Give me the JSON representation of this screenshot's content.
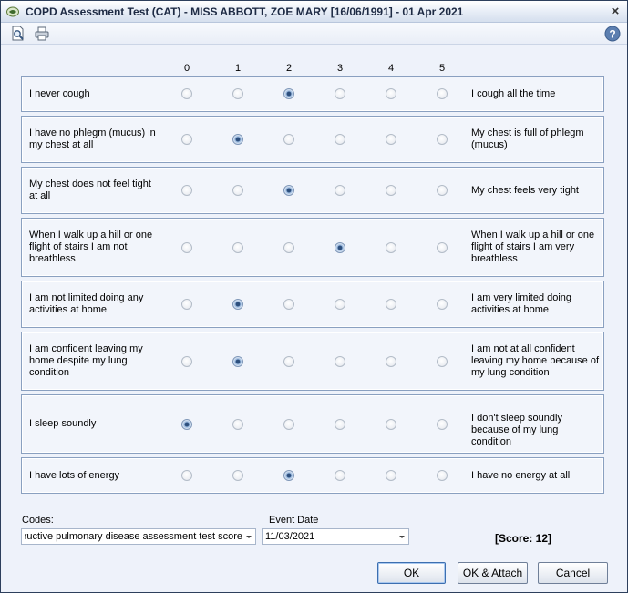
{
  "window": {
    "title": "COPD Assessment Test (CAT) - MISS ABBOTT, ZOE MARY [16/06/1991] - 01 Apr 2021",
    "close_label": "×"
  },
  "toolbar": {
    "preview_icon": "print-preview-icon",
    "print_icon": "printer-icon",
    "help_icon": "help-icon",
    "help_label": "?"
  },
  "scale": [
    "0",
    "1",
    "2",
    "3",
    "4",
    "5"
  ],
  "questions": [
    {
      "left": "I never cough",
      "right": "I cough all the time",
      "selected": 2
    },
    {
      "left": "I have no phlegm (mucus) in my chest at all",
      "right": "My chest is full of phlegm (mucus)",
      "selected": 1
    },
    {
      "left": "My chest does not feel tight at all",
      "right": "My chest feels very tight",
      "selected": 2
    },
    {
      "left": "When I walk up a hill or one flight of stairs I am not breathless",
      "right": "When I walk up a hill or one flight of stairs I am very breathless",
      "selected": 3
    },
    {
      "left": "I am not limited doing any activities at home",
      "right": "I am very limited doing activities at home",
      "selected": 1
    },
    {
      "left": "I am confident leaving my home despite my lung condition",
      "right": "I am not at all confident leaving my home because of my lung condition",
      "selected": 1
    },
    {
      "left": "I sleep soundly",
      "right": "I don't sleep soundly because of my lung condition",
      "selected": 0
    },
    {
      "left": "I have lots of energy",
      "right": "I have no energy at all",
      "selected": 2
    }
  ],
  "codes": {
    "label": "Codes:",
    "value": "Chronic obstructive pulmonary disease assessment test score"
  },
  "event_date": {
    "label": "Event Date",
    "value": "11/03/2021"
  },
  "score_text": "[Score: 12]",
  "buttons": {
    "ok": "OK",
    "ok_attach": "OK & Attach",
    "cancel": "Cancel"
  }
}
